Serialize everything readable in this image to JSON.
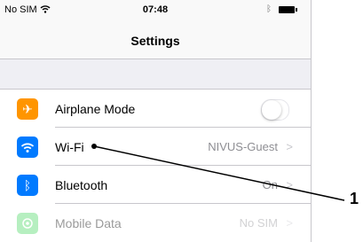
{
  "status_bar": {
    "carrier": "No SIM",
    "wifi_icon": "wifi-icon",
    "time": "07:48",
    "bluetooth_icon": "bluetooth-icon",
    "battery_icon": "battery-icon"
  },
  "nav": {
    "title": "Settings"
  },
  "settings_rows": [
    {
      "label": "Airplane Mode",
      "icon": "airplane-icon",
      "icon_color": "#ff9500",
      "value": "",
      "control": "toggle",
      "toggle_on": false
    },
    {
      "label": "Wi-Fi",
      "icon": "wifi-icon",
      "icon_color": "#007aff",
      "value": "NIVUS-Guest",
      "control": "chevron"
    },
    {
      "label": "Bluetooth",
      "icon": "bluetooth-icon",
      "icon_color": "#007aff",
      "value": "On",
      "control": "chevron"
    },
    {
      "label": "Mobile Data",
      "icon": "mobile-data-icon",
      "icon_color": "#4cd964",
      "value": "No SIM",
      "control": "chevron",
      "disabled": true
    }
  ],
  "callout": {
    "number": "1"
  }
}
